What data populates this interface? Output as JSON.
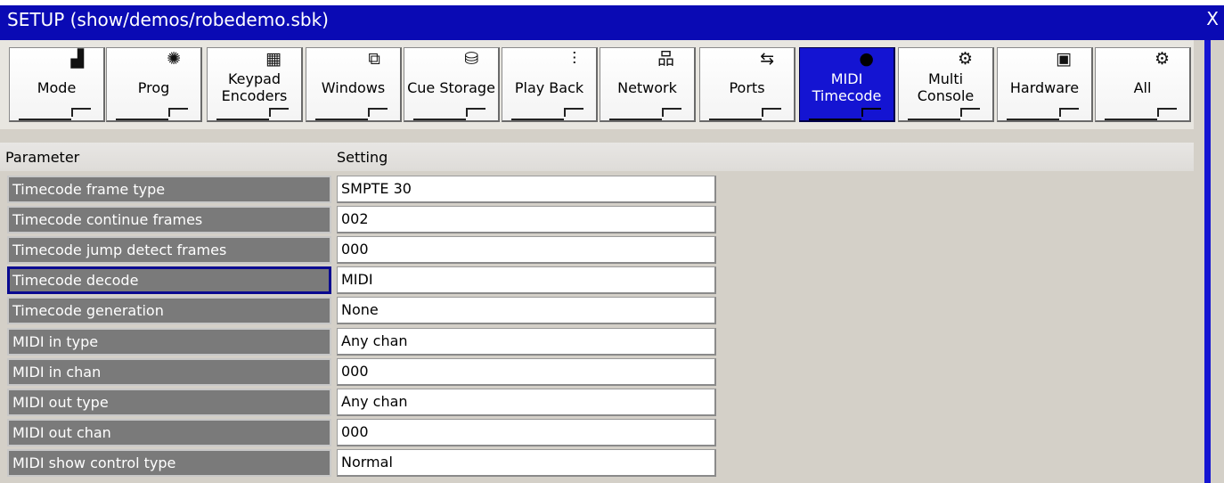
{
  "window": {
    "title": "SETUP (show/demos/robedemo.sbk)",
    "close_label": "X",
    "accent_color": "#1414d2"
  },
  "tabs": [
    {
      "name": "mode",
      "label": "Mode",
      "icon": "▟",
      "icon_name": "bar-chart-icon",
      "active": false
    },
    {
      "name": "prog",
      "label": "Prog",
      "icon": "✺",
      "icon_name": "fixture-icon",
      "active": false
    },
    {
      "name": "keypad-encoders",
      "label": "Keypad\nEncoders",
      "icon": "▦",
      "icon_name": "keypad-icon",
      "active": false
    },
    {
      "name": "windows",
      "label": "Windows",
      "icon": "⧉",
      "icon_name": "windows-icon",
      "active": false
    },
    {
      "name": "cue-storage",
      "label": "Cue Storage",
      "icon": "⛁",
      "icon_name": "database-icon",
      "active": false
    },
    {
      "name": "play-back",
      "label": "Play Back",
      "icon": "⫶",
      "icon_name": "faders-icon",
      "active": false
    },
    {
      "name": "network",
      "label": "Network",
      "icon": "品",
      "icon_name": "network-icon",
      "active": false
    },
    {
      "name": "ports",
      "label": "Ports",
      "icon": "⇆",
      "icon_name": "usb-icon",
      "active": false
    },
    {
      "name": "midi-timecode",
      "label": "MIDI\nTimecode",
      "icon": "●",
      "icon_name": "midi-connector-icon",
      "active": true
    },
    {
      "name": "multi-console",
      "label": "Multi\nConsole",
      "icon": "⚙",
      "icon_name": "gear-icon",
      "active": false
    },
    {
      "name": "hardware",
      "label": "Hardware",
      "icon": "▣",
      "icon_name": "chip-icon",
      "active": false
    },
    {
      "name": "all",
      "label": "All",
      "icon": "⚙",
      "icon_name": "gear-icon",
      "active": false
    }
  ],
  "table": {
    "headers": {
      "parameter": "Parameter",
      "setting": "Setting"
    },
    "rows": [
      {
        "param": "Timecode frame type",
        "value": "SMPTE 30",
        "selected": false
      },
      {
        "param": "Timecode continue frames",
        "value": "002",
        "selected": false
      },
      {
        "param": "Timecode jump detect frames",
        "value": "000",
        "selected": false
      },
      {
        "param": "Timecode decode",
        "value": "MIDI",
        "selected": true
      },
      {
        "param": "Timecode generation",
        "value": "None",
        "selected": false
      },
      {
        "param": "MIDI in type",
        "value": "Any chan",
        "selected": false
      },
      {
        "param": "MIDI in chan",
        "value": "000",
        "selected": false
      },
      {
        "param": "MIDI out type",
        "value": "Any chan",
        "selected": false
      },
      {
        "param": "MIDI out chan",
        "value": "000",
        "selected": false
      },
      {
        "param": "MIDI show control type",
        "value": "Normal",
        "selected": false
      }
    ]
  }
}
